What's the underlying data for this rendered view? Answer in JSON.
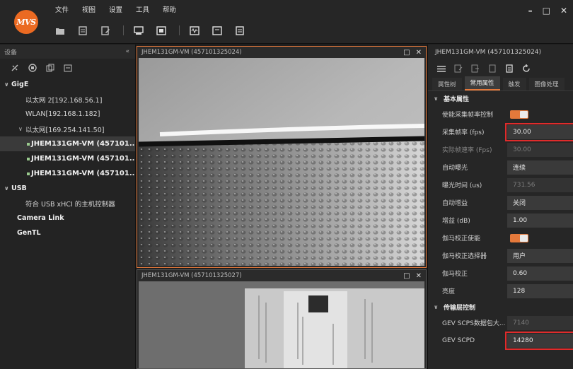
{
  "menu": [
    "文件",
    "视图",
    "设置",
    "工具",
    "帮助"
  ],
  "logo": "MVS",
  "window_controls": {
    "minimize": "–",
    "maximize": "□",
    "close": "✕"
  },
  "left_panel": {
    "title": "设备",
    "collapse": "«",
    "tree": {
      "gige": "GigE",
      "net1": "以太网 2[192.168.56.1]",
      "net2": "WLAN[192.168.1.182]",
      "net3": "以太网[169.254.141.50]",
      "cam1": "JHEM131GM-VM (457101...",
      "cam2": "JHEM131GM-VM (457101...",
      "cam3": "JHEM131GM-VM (457101...",
      "usb": "USB",
      "usb_ctrl": "符合 USB xHCI 的主机控制器",
      "camlink": "Camera Link",
      "gentl": "GenTL"
    }
  },
  "view1": {
    "title": "JHEM131GM-VM (457101325024)",
    "ctl_max": "□",
    "ctl_close": "✕"
  },
  "view2": {
    "title": "JHEM131GM-VM (457101325027)",
    "ctl_max": "□",
    "ctl_close": "✕"
  },
  "right_panel": {
    "title": "JHEM131GM-VM (457101325024)",
    "tabs": [
      "属性树",
      "常用属性",
      "触发",
      "图像处理"
    ],
    "section_basic": "基本属性",
    "section_transport": "传输层控制",
    "props": {
      "framerate_enable": {
        "label": "使能采集帧率控制"
      },
      "framerate": {
        "label": "采集帧率 (fps)",
        "value": "30.00"
      },
      "actual_rate": {
        "label": "实际帧速率 (Fps)",
        "value": "30.00"
      },
      "auto_exposure": {
        "label": "自动曝光",
        "value": "连续"
      },
      "exposure_time": {
        "label": "曝光时间 (us)",
        "value": "731.56"
      },
      "auto_gain": {
        "label": "自动增益",
        "value": "关闭"
      },
      "gain": {
        "label": "增益 (dB)",
        "value": "1.00"
      },
      "gamma_enable": {
        "label": "伽马校正使能"
      },
      "gamma_selector": {
        "label": "伽马校正选择器",
        "value": "用户"
      },
      "gamma": {
        "label": "伽马校正",
        "value": "0.60"
      },
      "brightness": {
        "label": "亮度",
        "value": "128"
      },
      "packet_size": {
        "label": "GEV SCPS数据包大...",
        "value": "7140"
      },
      "scpd": {
        "label": "GEV SCPD",
        "value": "14280"
      }
    }
  },
  "colors": {
    "accent": "#e4793b",
    "highlight": "#e02b2b",
    "camera_ok": "#3fa84a"
  }
}
